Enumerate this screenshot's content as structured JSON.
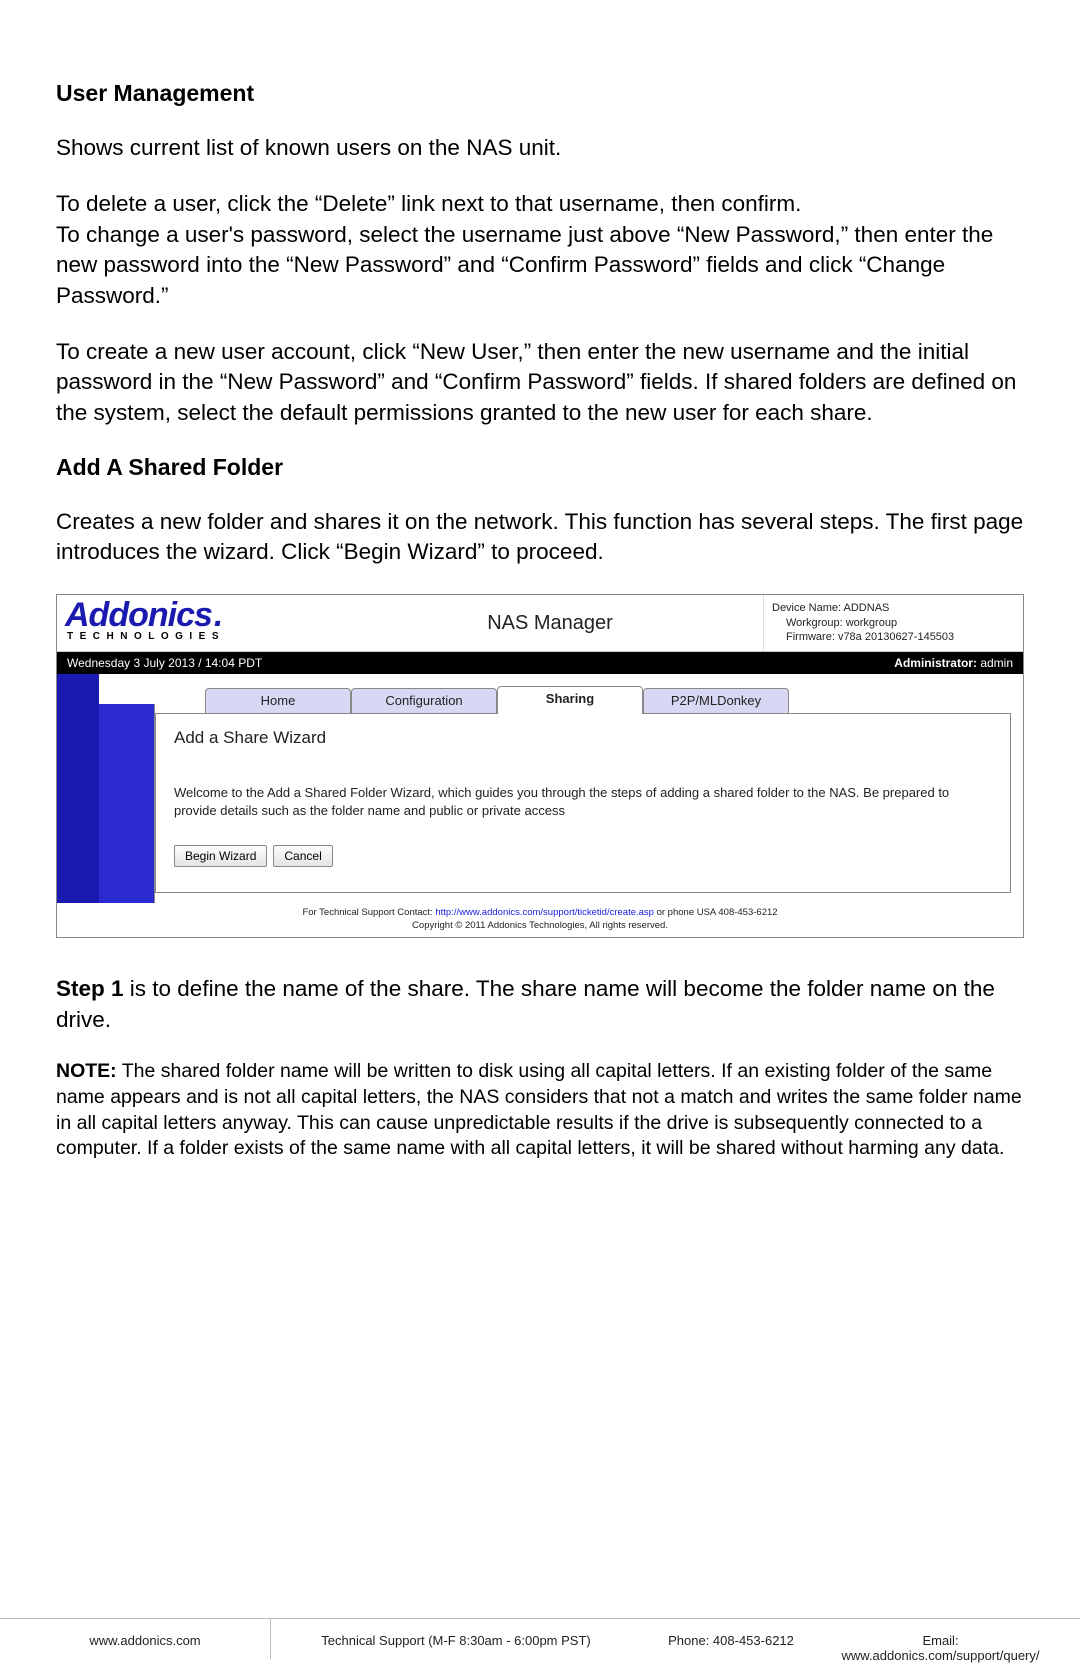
{
  "doc": {
    "h_user_mgmt": "User Management",
    "p_intro": "Shows current list of known users on the NAS unit.",
    "p_delete": "To delete a user, click the “Delete” link next to that username, then confirm.\nTo change a user's password, select the username just above “New Password,” then enter the new password into the “New Password” and “Confirm Password” fields and click “Change Password.”",
    "p_newuser": "To create a new user account, click “New User,” then enter the new username and the initial password in the “New Password” and “Confirm Password” fields. If shared folders are defined on the system, select the default permissions granted to the new user for each share.",
    "h_add_share": "Add A Shared Folder",
    "p_add_share": "Creates a new folder and shares it on the network. This function has several steps. The first page introduces the wizard. Click “Begin Wizard” to proceed.",
    "step1_bold": "Step 1",
    "step1_rest": " is to define the name of the share. The share name will become the folder name on the drive.",
    "note_bold": "NOTE:",
    "note_rest": " The shared folder name will be written to disk using all capital letters. If an existing folder of the same name appears and is not all capital letters, the NAS considers that not a match and writes the same folder name in all capital letters anyway. This can cause unpredictable results if the drive is subsequently connected to a computer. If a folder exists of the same name with all capital letters, it will be shared without harming any data."
  },
  "embed": {
    "logo_main": "Addonics",
    "logo_dot": ".",
    "logo_sub": "TECHNOLOGIES",
    "app_title": "NAS Manager",
    "device_name": "Device Name: ADDNAS",
    "workgroup": "Workgroup: workgroup",
    "firmware": "Firmware: v78a 20130627-145503",
    "datetime": "Wednesday 3 July 2013 / 14:04 PDT",
    "admin_label": "Administrator: ",
    "admin_user": "admin",
    "tabs": {
      "home": "Home",
      "config": "Configuration",
      "sharing": "Sharing",
      "p2p": "P2P/MLDonkey"
    },
    "wizard_title": "Add a Share Wizard",
    "wizard_text": "Welcome to the Add a Shared Folder Wizard, which guides you through the steps of adding a shared folder to the NAS. Be prepared to provide details such as the folder name and public or private access",
    "btn_begin": "Begin Wizard",
    "btn_cancel": "Cancel",
    "footer1_pre": "For Technical Support Contact: ",
    "footer1_link": "http://www.addonics.com/support/ticketid/create.asp",
    "footer1_post": " or phone USA 408-453-6212",
    "footer2": "Copyright © 2011 Addonics Technologies, All rights reserved."
  },
  "footer": {
    "web": "www.addonics.com",
    "support": "Technical Support (M-F 8:30am - 6:00pm PST)",
    "phone": "Phone: 408-453-6212",
    "email": "Email: www.addonics.com/support/query/"
  }
}
